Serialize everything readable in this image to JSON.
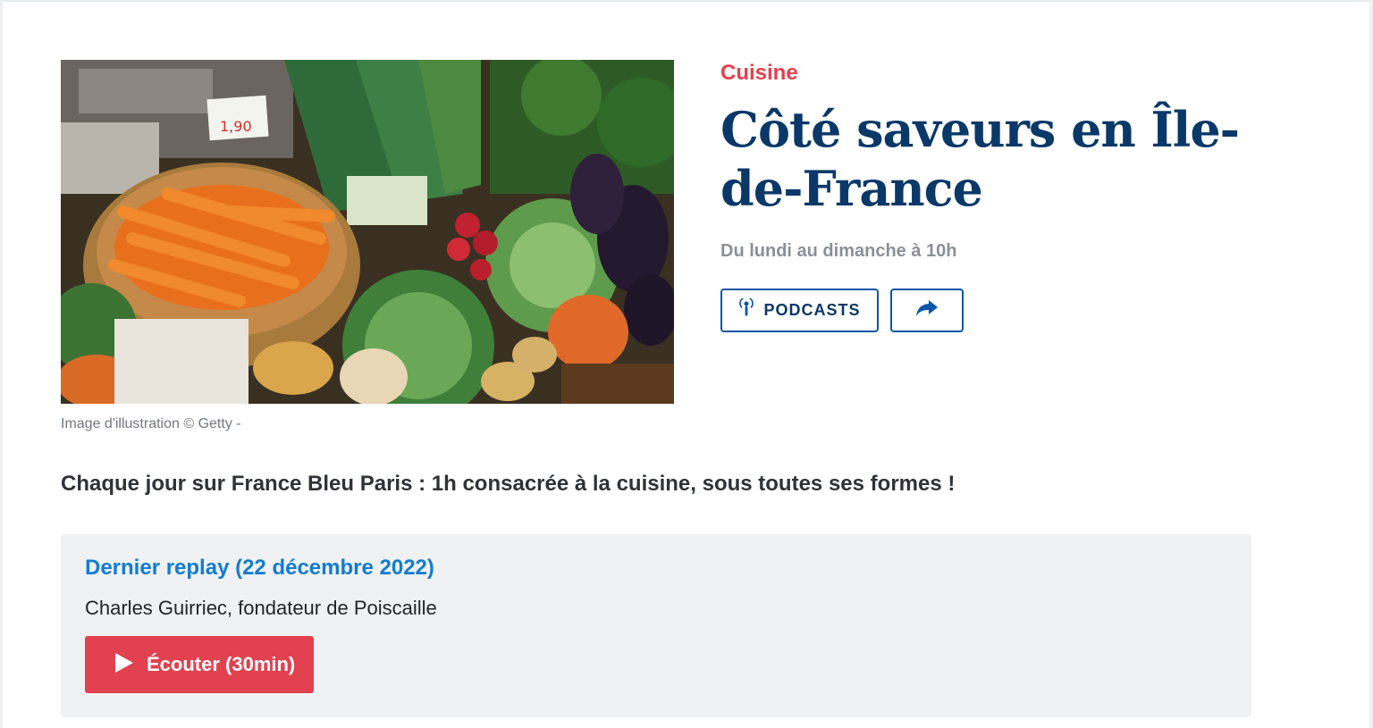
{
  "image": {
    "caption": "Image d'illustration © Getty -",
    "price_tag_text": "1,90"
  },
  "show": {
    "category": "Cuisine",
    "title": "Côté saveurs en Île-de-France",
    "schedule": "Du lundi au dimanche à 10h",
    "podcasts_label": "PODCASTS",
    "description": "Chaque jour sur France Bleu Paris : 1h consacrée à la cuisine, sous toutes ses formes !"
  },
  "replay": {
    "title": "Dernier replay (22 décembre 2022)",
    "subtitle": "Charles Guirriec, fondateur de Poiscaille",
    "listen_label": "Écouter (30min)"
  },
  "icons": {
    "podcast": "podcast-icon",
    "share": "share-arrow-icon",
    "play": "play-icon"
  },
  "colors": {
    "accent_red": "#e5404d",
    "title_navy": "#0a3868",
    "link_blue": "#127cd1",
    "button_red": "#e2414f",
    "card_bg": "#eff1f3"
  }
}
